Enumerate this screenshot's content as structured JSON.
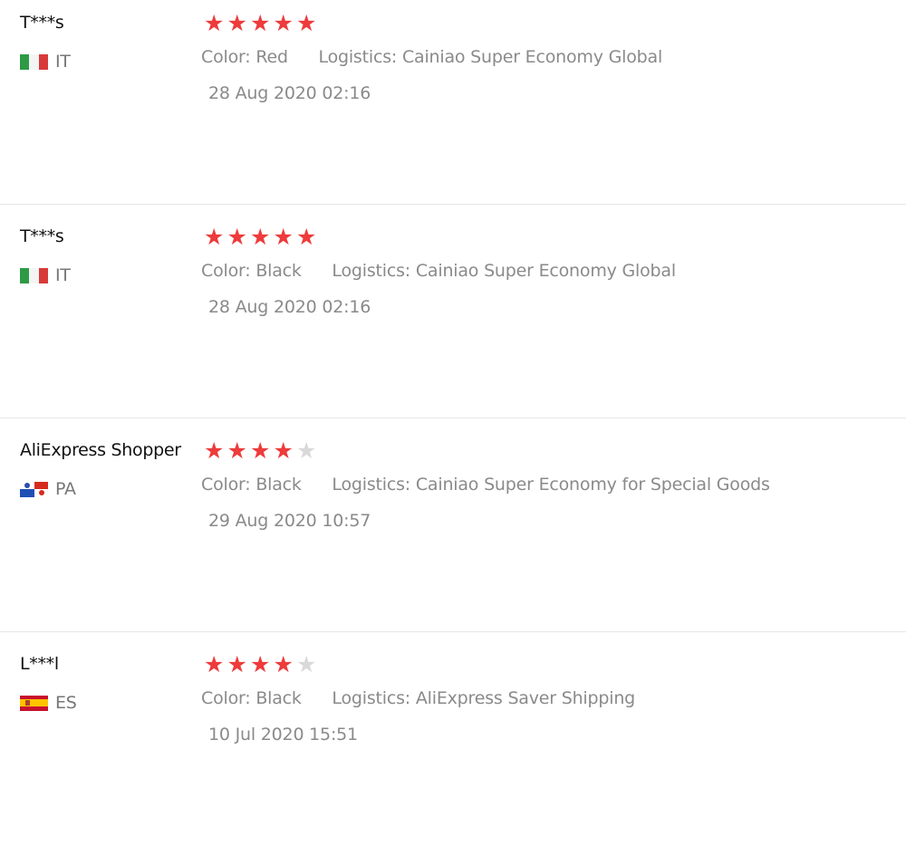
{
  "reviews": [
    {
      "name": "T***s",
      "country": "IT",
      "flag_icon": "italy-flag-icon",
      "rating": 5,
      "color_label": "Color:",
      "color_value": "Red",
      "logistics_label": "Logistics:",
      "logistics_value": "Cainiao Super Economy Global",
      "date": "28 Aug 2020 02:16"
    },
    {
      "name": "T***s",
      "country": "IT",
      "flag_icon": "italy-flag-icon",
      "rating": 5,
      "color_label": "Color:",
      "color_value": "Black",
      "logistics_label": "Logistics:",
      "logistics_value": "Cainiao Super Economy Global",
      "date": "28 Aug 2020 02:16"
    },
    {
      "name": "AliExpress Shopper",
      "country": "PA",
      "flag_icon": "panama-flag-icon",
      "rating": 4,
      "color_label": "Color:",
      "color_value": "Black",
      "logistics_label": "Logistics:",
      "logistics_value": "Cainiao Super Economy for Special Goods",
      "date": "29 Aug 2020 10:57"
    },
    {
      "name": "L***l",
      "country": "ES",
      "flag_icon": "spain-flag-icon",
      "rating": 4,
      "color_label": "Color:",
      "color_value": "Black",
      "logistics_label": "Logistics:",
      "logistics_value": "AliExpress Saver Shipping",
      "date": "10 Jul 2020 15:51"
    }
  ],
  "max_rating": 5,
  "colors": {
    "star_on": "#ee3b3b",
    "star_off": "#d9d9d9",
    "muted_text": "#8a8a8a",
    "separator": "#e6e6e6"
  }
}
